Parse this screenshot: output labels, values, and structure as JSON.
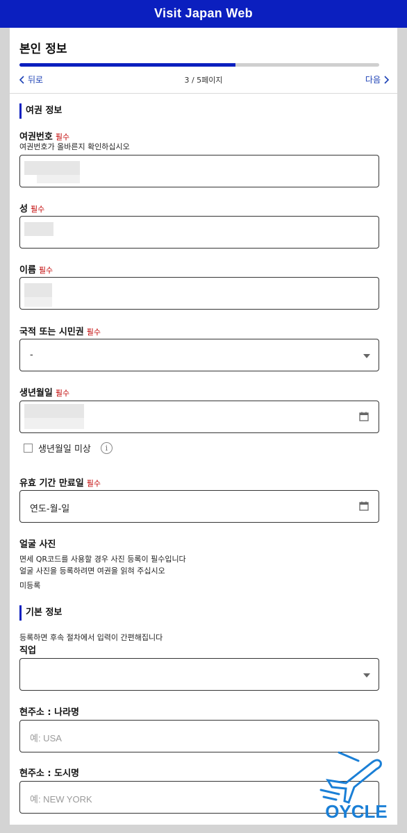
{
  "app": {
    "title": "Visit Japan Web"
  },
  "header": {
    "page_title": "본인 정보",
    "progress": 0.6,
    "back_label": "뒤로",
    "page_indicator": "3 / 5페이지",
    "next_label": "다음"
  },
  "passport_section": {
    "title": "여권 정보",
    "required_label": "필수",
    "passport_number": {
      "label": "여권번호",
      "hint": "여권번호가 올바른지 확인하십시오"
    },
    "surname": {
      "label": "성"
    },
    "given_name": {
      "label": "이름"
    },
    "nationality": {
      "label": "국적 또는 시민권",
      "value": "-"
    },
    "birth_date": {
      "label": "생년월일",
      "unknown_label": "생년월일 미상"
    },
    "expiry_date": {
      "label": "유효 기간 만료일",
      "placeholder": "연도-월-일"
    },
    "face_photo": {
      "label": "얼굴 사진",
      "hint_line1": "면세 QR코드를 사용할 경우 사진 등록이 필수입니다",
      "hint_line2": "얼굴 사진을 등록하려면 여권을 읽혀 주십시오",
      "status": "미등록"
    }
  },
  "basic_section": {
    "title": "기본 정보",
    "hint": "등록하면 후속 절차에서 입력이 간편해집니다",
    "occupation": {
      "label": "직업",
      "value": ""
    },
    "country": {
      "label": "현주소 : 나라명",
      "placeholder": "예: USA"
    },
    "city": {
      "label": "현주소 : 도시명",
      "placeholder": "예: NEW YORK"
    }
  },
  "watermark": {
    "text": "OYCLE",
    "color": "#1a7fd6"
  },
  "icons": {
    "back": "chevron-left-icon",
    "next": "chevron-right-icon",
    "dropdown": "caret-down-icon",
    "calendar": "calendar-icon",
    "info": "info-icon"
  },
  "colors": {
    "brand": "#0b1fbf",
    "required": "#c00000",
    "link": "#1a3fb5"
  }
}
